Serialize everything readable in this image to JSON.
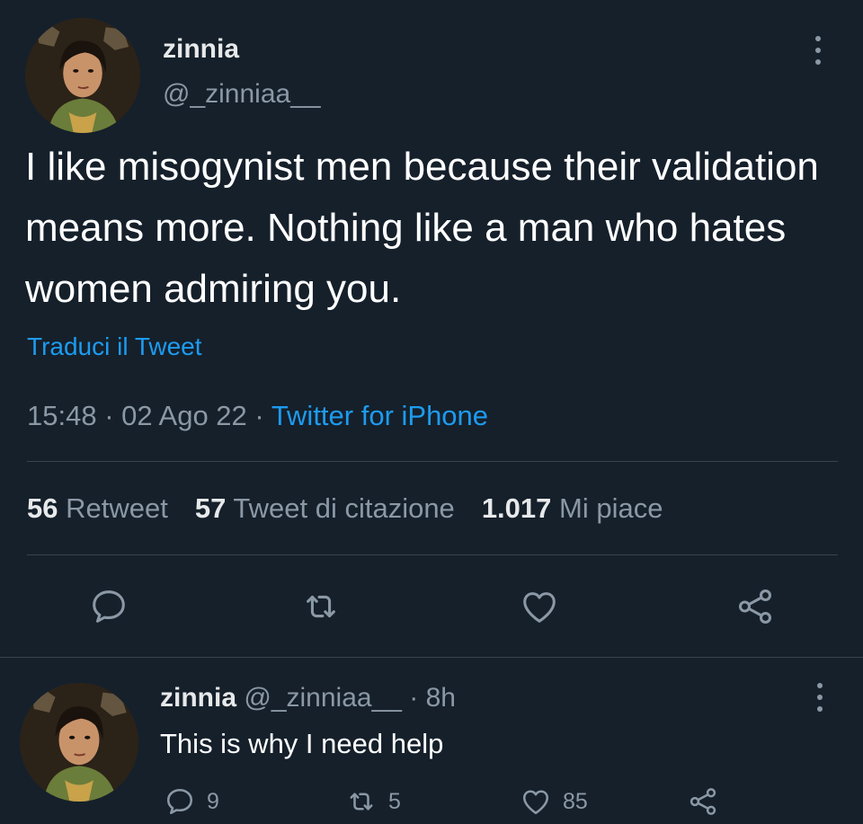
{
  "tweet": {
    "author_name": "zinnia",
    "author_handle": "@_zinniaa__",
    "text": "I like misogynist men because their validation means more. Nothing like a man who hates women admiring you.",
    "translate_link": "Traduci il Tweet",
    "time": "15:48",
    "date": "02 Ago 22",
    "separator": "·",
    "source": "Twitter for iPhone",
    "stats": {
      "retweets_count": "56",
      "retweets_label": "Retweet",
      "quotes_count": "57",
      "quotes_label": "Tweet di citazione",
      "likes_count": "1.017",
      "likes_label": "Mi piace"
    },
    "icons": [
      "reply-icon",
      "retweet-icon",
      "like-icon",
      "share-icon",
      "more-icon"
    ]
  },
  "reply": {
    "author_name": "zinnia",
    "author_handle": "@_zinniaa__",
    "age": "· 8h",
    "text": "This is why I need help",
    "reply_count": "9",
    "retweet_count": "5",
    "like_count": "85"
  },
  "colors": {
    "background": "#15202b",
    "accent": "#1d9bf0",
    "secondary_text": "#8b98a5",
    "divider": "#38444d"
  }
}
